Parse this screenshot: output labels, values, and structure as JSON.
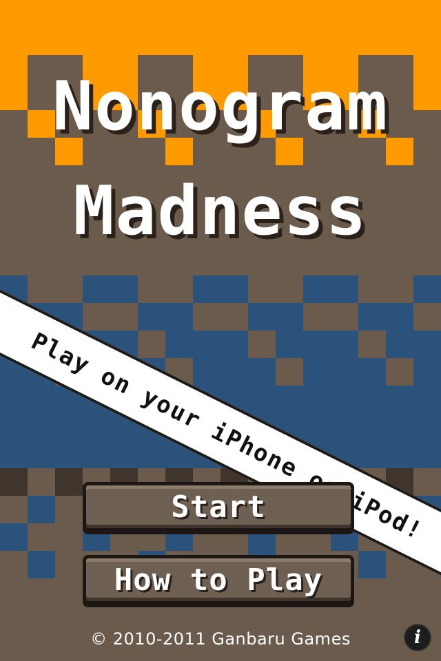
{
  "title": {
    "line1": "Nonogram",
    "line2": "Madness"
  },
  "banner": {
    "text": "Play on your iPhone or iPod!"
  },
  "menu": {
    "start_label": "Start",
    "how_to_play_label": "How to Play"
  },
  "footer": {
    "copyright": "© 2010-2011 Ganbaru Games"
  },
  "info_button": {
    "icon": "info-icon",
    "glyph": "i"
  },
  "colors": {
    "orange": "#ff9a00",
    "brown": "#6b5b4d",
    "blue": "#2b527b",
    "dark_brown": "#3f352c",
    "white": "#ffffff",
    "banner_outline": "#1e1a17"
  }
}
